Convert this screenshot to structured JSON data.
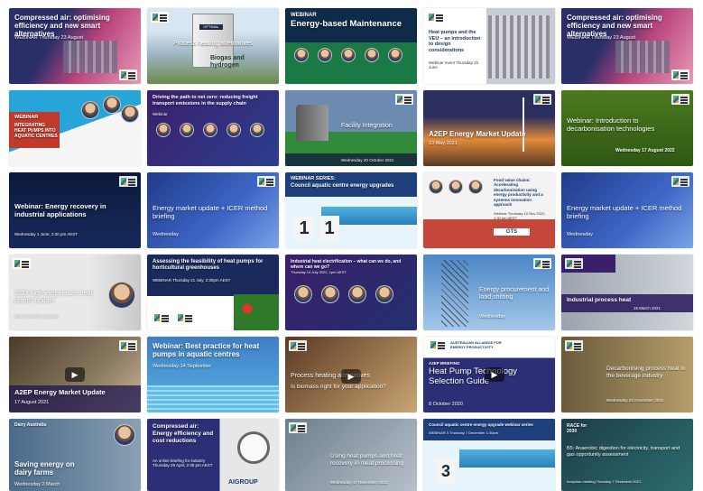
{
  "tiles": [
    {
      "title": "Compressed air: optimising efficiency and new smart alternatives",
      "sub": "WEBINAR  Thursday 23 August"
    },
    {
      "title": "Process heating alternatives",
      "sub": "Biogas and hydrogen",
      "label": "OPTIMAL"
    },
    {
      "title": "WEBINAR",
      "title2": "Energy-based Maintenance"
    },
    {
      "title": "Heat pumps and the VEU – an introduction to design considerations",
      "sub": "Webinar event  Thursday 22 June"
    },
    {
      "title": "Compressed air: optimising efficiency and new smart alternatives",
      "sub": "WEBINAR  Thursday 23 August"
    },
    {
      "title": "WEBINAR",
      "title2": "INTEGRATING HEAT PUMPS INTO AQUATIC CENTRES"
    },
    {
      "title": "Driving the path to net zero: reducing freight transport emissions in the supply chain",
      "sub": "Webinar"
    },
    {
      "title": "Facility Integration",
      "sub": "Wednesday 20 October 2021"
    },
    {
      "title": "A2EP Energy Market Update",
      "sub": "13 May 2021"
    },
    {
      "title": "Webinar: Introduction to decarbonisation technologies",
      "sub": "Wednesday 17 August 2022"
    },
    {
      "title": "Webinar: Energy recovery in industrial applications",
      "sub": "Wednesday 1 June, 2:30 pm AEST"
    },
    {
      "title": "Energy market update + ICER method briefing",
      "sub": "Wednesday"
    },
    {
      "title": "WEBINAR SERIES:",
      "title2": "Council aquatic centre energy upgrades",
      "num1": "1",
      "num2": "1"
    },
    {
      "title": "Food value chains: Accelerating decarbonisation using energy productivity and a systems innovation approach",
      "sub": "Webinar  Thursday 10 Nov 2022, 1:30 pm AEDT",
      "brand": "GTS"
    },
    {
      "title": "Energy market update + ICER method briefing",
      "sub": "Wednesday"
    },
    {
      "title": "2023 high-temperature heat pumps update",
      "sub": "with Dr Cordin Arpagaus"
    },
    {
      "title": "Assessing the feasibility of heat pumps for horticultural greenhouses",
      "sub": "WEBINAR  Thursday 21 July, 2:30pm AEST"
    },
    {
      "title": "Industrial heat electrification – what can we do, and where can we go?",
      "sub": "Thursday 14 July 2022, 1pm AEST"
    },
    {
      "title": "Energy procurement and load shifting",
      "sub": "Wednesday"
    },
    {
      "title": "Industrial process heat",
      "sub": "16 March 2021"
    },
    {
      "title": "A2EP Energy Market Update",
      "sub": "17 August 2021"
    },
    {
      "title": "Webinar: Best practice for heat pumps in aquatic centres",
      "sub": "Wednesday 14 September"
    },
    {
      "title": "Process heating alternatives",
      "title2": "Is biomass right for your application?"
    },
    {
      "title": "A2EP BRIEFING",
      "title2": "Heat Pump Technology Selection Guide",
      "sub": "8 October 2020",
      "logo": "AUSTRALIAN ALLIANCE FOR ENERGY PRODUCTIVITY"
    },
    {
      "title": "Decarbonising process heat in the beverage industry",
      "sub": "Wednesday 23 November 2022"
    },
    {
      "title": "Saving energy on dairy farms",
      "sub": "Wednesday 2 March",
      "brand": "Dairy Australia"
    },
    {
      "title": "Compressed air: Energy efficiency and cost reductions",
      "sub": "An online briefing for industry  Thursday 29 April, 2:30 pm AEST",
      "brand": "AIGROUP"
    },
    {
      "title": "Using heat pumps and heat recovery in meat processing",
      "sub": "Wednesday 17 November 2021"
    },
    {
      "title": "Council aquatic centre energy upgrade webinar series",
      "sub": "WEBINAR 3  Thursday 7 December 1:30pm",
      "num1": "3"
    },
    {
      "title": "B5: Anaerobic digestion for electricity, transport and gas opportunity assessment",
      "sub": "Inception meeting  Thursday 7 December 2021",
      "tag": "RACE for 2030"
    }
  ]
}
